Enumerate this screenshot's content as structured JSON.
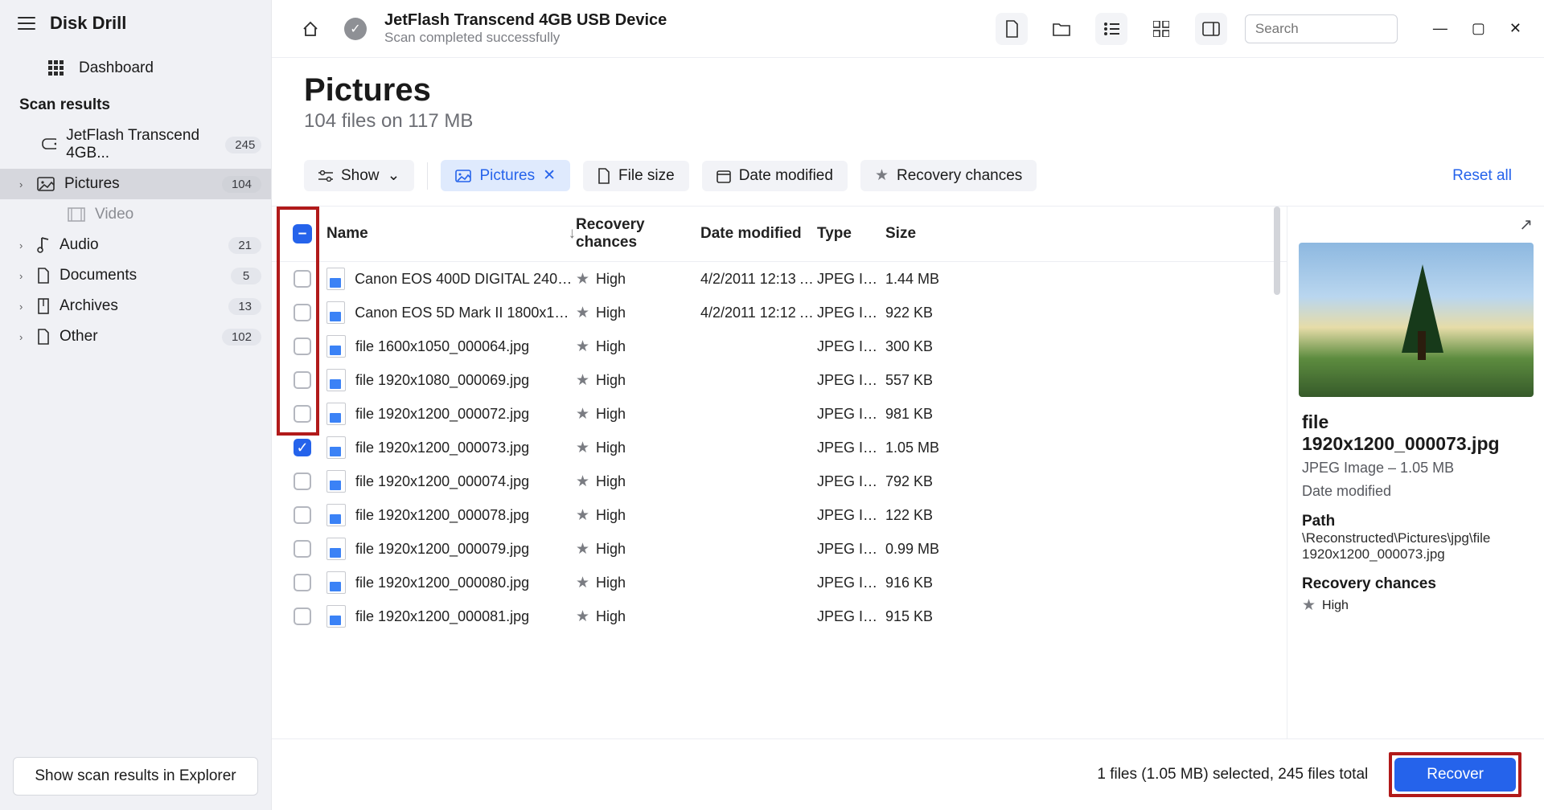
{
  "brand": "Disk Drill",
  "dashboard_label": "Dashboard",
  "section_title": "Scan results",
  "device": {
    "name": "JetFlash Transcend 4GB...",
    "count": "245"
  },
  "tree": [
    {
      "label": "Pictures",
      "count": "104",
      "selected": true,
      "chev": true
    },
    {
      "label": "Video",
      "count": "",
      "dim": true,
      "indent": true
    },
    {
      "label": "Audio",
      "count": "21",
      "chev": true
    },
    {
      "label": "Documents",
      "count": "5",
      "chev": true
    },
    {
      "label": "Archives",
      "count": "13",
      "chev": true
    },
    {
      "label": "Other",
      "count": "102",
      "chev": true
    }
  ],
  "explorer_btn": "Show scan results in Explorer",
  "topbar": {
    "title": "JetFlash Transcend 4GB USB Device",
    "sub": "Scan completed successfully",
    "search_placeholder": "Search"
  },
  "heading": {
    "title": "Pictures",
    "sub": "104 files on 117 MB"
  },
  "filters": {
    "show": "Show",
    "pictures": "Pictures",
    "filesize": "File size",
    "datemod": "Date modified",
    "recchance": "Recovery chances",
    "reset": "Reset all"
  },
  "columns": {
    "name": "Name",
    "rec": "Recovery chances",
    "date": "Date modified",
    "type": "Type",
    "size": "Size"
  },
  "rows": [
    {
      "name": "Canon EOS 400D DIGITAL 2400x...",
      "rec": "High",
      "date": "4/2/2011 12:13 A...",
      "type": "JPEG Im...",
      "size": "1.44 MB",
      "checked": false
    },
    {
      "name": "Canon EOS 5D Mark II 1800x120...",
      "rec": "High",
      "date": "4/2/2011 12:12 A...",
      "type": "JPEG Im...",
      "size": "922 KB",
      "checked": false
    },
    {
      "name": "file 1600x1050_000064.jpg",
      "rec": "High",
      "date": "",
      "type": "JPEG Im...",
      "size": "300 KB",
      "checked": false
    },
    {
      "name": "file 1920x1080_000069.jpg",
      "rec": "High",
      "date": "",
      "type": "JPEG Im...",
      "size": "557 KB",
      "checked": false
    },
    {
      "name": "file 1920x1200_000072.jpg",
      "rec": "High",
      "date": "",
      "type": "JPEG Im...",
      "size": "981 KB",
      "checked": false
    },
    {
      "name": "file 1920x1200_000073.jpg",
      "rec": "High",
      "date": "",
      "type": "JPEG Im...",
      "size": "1.05 MB",
      "checked": true
    },
    {
      "name": "file 1920x1200_000074.jpg",
      "rec": "High",
      "date": "",
      "type": "JPEG Im...",
      "size": "792 KB",
      "checked": false
    },
    {
      "name": "file 1920x1200_000078.jpg",
      "rec": "High",
      "date": "",
      "type": "JPEG Im...",
      "size": "122 KB",
      "checked": false
    },
    {
      "name": "file 1920x1200_000079.jpg",
      "rec": "High",
      "date": "",
      "type": "JPEG Im...",
      "size": "0.99 MB",
      "checked": false
    },
    {
      "name": "file 1920x1200_000080.jpg",
      "rec": "High",
      "date": "",
      "type": "JPEG Im...",
      "size": "916 KB",
      "checked": false
    },
    {
      "name": "file 1920x1200_000081.jpg",
      "rec": "High",
      "date": "",
      "type": "JPEG Im...",
      "size": "915 KB",
      "checked": false
    }
  ],
  "detail": {
    "name": "file 1920x1200_000073.jpg",
    "typesize": "JPEG Image – 1.05 MB",
    "datemod_label": "Date modified",
    "path_label": "Path",
    "path": "\\Reconstructed\\Pictures\\jpg\\file 1920x1200_000073.jpg",
    "rec_label": "Recovery chances",
    "rec_value": "High"
  },
  "footer": {
    "status": "1 files (1.05 MB) selected, 245 files total",
    "recover": "Recover"
  }
}
